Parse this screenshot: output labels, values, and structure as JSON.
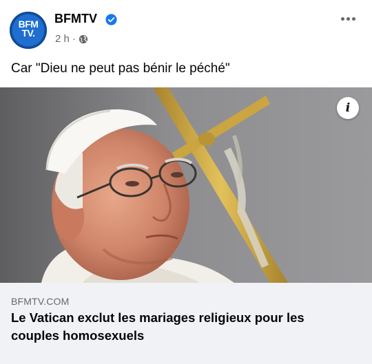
{
  "page": {
    "name": "BFMTV",
    "avatar_text_line1": "BFM",
    "avatar_text_line2": "TV.",
    "verified": true,
    "timestamp": "2 h",
    "separator": "·",
    "audience_icon": "globe-icon"
  },
  "post": {
    "caption": "Car \"Dieu ne peut pas bénir le péché\""
  },
  "link_preview": {
    "domain": "BFMTV.COM",
    "headline": "Le Vatican exclut les mariages religieux pour les couples homosexuels"
  },
  "icons": {
    "more": "more-options-icon",
    "info": "info-icon",
    "verified": "verified-badge-icon"
  },
  "colors": {
    "brand_blue": "#1e6fd0",
    "verified_blue": "#1877f2",
    "secondary_text": "#65676b",
    "link_box_bg": "#f0f2f5"
  }
}
